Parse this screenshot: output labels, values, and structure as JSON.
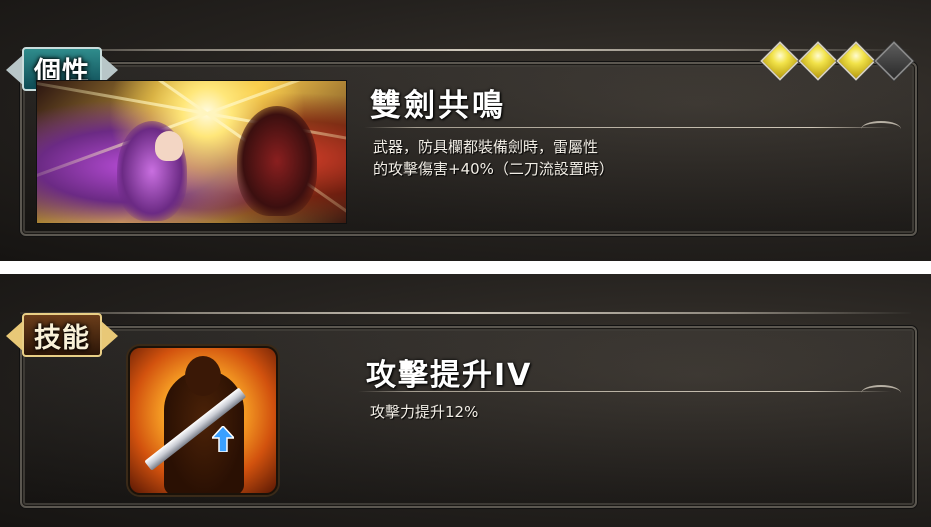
{
  "personality": {
    "badge_label": "個性",
    "rarity": {
      "filled": 3,
      "total": 4,
      "filled_color": "#f2e34a",
      "empty_color": "#3a3a3a"
    },
    "title": "雙劍共鳴",
    "description_lines": [
      "武器，防具欄都裝備劍時，雷屬性",
      "的攻擊傷害+40%（二刀流設置時）"
    ]
  },
  "skill": {
    "badge_label": "技能",
    "title": "攻擊提升IV",
    "description_lines": [
      "攻擊力提升12%"
    ]
  },
  "colors": {
    "personality_badge": "#1f6a6e",
    "skill_badge": "#6b3d1a",
    "panel_bg": "#24211e",
    "text": "#ffffff"
  }
}
